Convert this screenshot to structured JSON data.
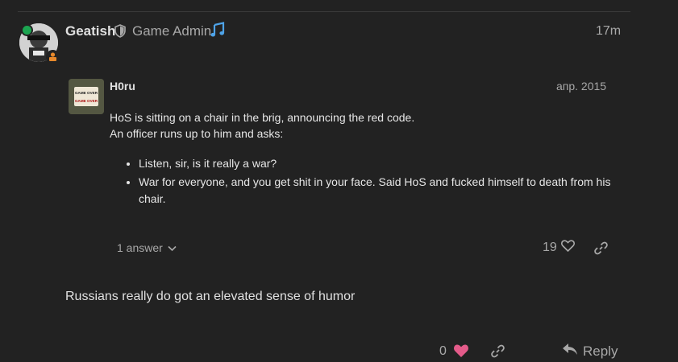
{
  "post": {
    "username": "Geatish",
    "user_title": "Game Admin",
    "time": "17m",
    "text": "Russians really do got an elevated sense of humor"
  },
  "quote": {
    "username": "H0ru",
    "date": "апр. 2015",
    "avatar_sign": [
      "GAME OVER",
      "GAME OVER"
    ],
    "paragraph_1": "HoS is sitting on a chair in the brig, announcing the red code.",
    "paragraph_2": "An officer runs up to him and asks:",
    "bullets": [
      "Listen, sir, is it really a war?",
      "War for everyone, and you get shit in your face. Said HoS and fucked himself to death from his chair."
    ],
    "answers_label": "1 answer",
    "likes": "19"
  },
  "actions": {
    "likes": "0",
    "reply_label": "Reply"
  },
  "colors": {
    "background": "#222222",
    "online": "#1ca551",
    "music_icon": "#4ea3e8",
    "heart": "#e45b8a"
  },
  "icons": [
    "shield-icon",
    "music-note-icon",
    "chevron-down-icon",
    "heart-icon",
    "link-icon",
    "reply-icon"
  ]
}
